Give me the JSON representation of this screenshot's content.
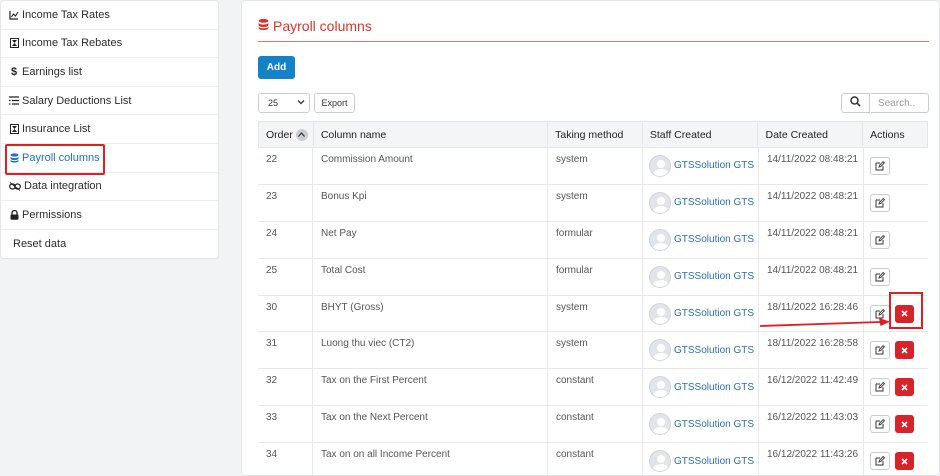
{
  "sidebar": {
    "items": [
      {
        "label": "Income Tax Rates",
        "icon": "chart-icon"
      },
      {
        "label": "Income Tax Rebates",
        "icon": "hourglass-icon"
      },
      {
        "label": "Earnings list",
        "icon": "dollar-icon"
      },
      {
        "label": "Salary Deductions List",
        "icon": "list-icon"
      },
      {
        "label": "Insurance List",
        "icon": "hourglass-icon"
      },
      {
        "label": "Payroll columns",
        "icon": "database-icon",
        "active": true
      },
      {
        "label": "Data integration",
        "icon": "link-icon"
      },
      {
        "label": "Permissions",
        "icon": "lock-icon"
      },
      {
        "label": "Reset data",
        "icon": ""
      }
    ]
  },
  "page": {
    "title": "Payroll columns",
    "add_label": "Add",
    "page_size": "25",
    "export_label": "Export",
    "search_placeholder": "Search.."
  },
  "table": {
    "columns": [
      "Order",
      "Column name",
      "Taking method",
      "Staff Created",
      "Date Created",
      "Actions"
    ],
    "rows": [
      {
        "order": "22",
        "name": "Commission Amount",
        "method": "system",
        "staff": "GTSSolution GTS",
        "date": "14/11/2022 08:48:21",
        "deletable": false
      },
      {
        "order": "23",
        "name": "Bonus Kpi",
        "method": "system",
        "staff": "GTSSolution GTS",
        "date": "14/11/2022 08:48:21",
        "deletable": false
      },
      {
        "order": "24",
        "name": "Net Pay",
        "method": "formular",
        "staff": "GTSSolution GTS",
        "date": "14/11/2022 08:48:21",
        "deletable": false
      },
      {
        "order": "25",
        "name": "Total Cost",
        "method": "formular",
        "staff": "GTSSolution GTS",
        "date": "14/11/2022 08:48:21",
        "deletable": false
      },
      {
        "order": "30",
        "name": "BHYT (Gross)",
        "method": "system",
        "staff": "GTSSolution GTS",
        "date": "18/11/2022 16:28:46",
        "deletable": true
      },
      {
        "order": "31",
        "name": "Luong thu viec (CT2)",
        "method": "system",
        "staff": "GTSSolution GTS",
        "date": "18/11/2022 16:28:58",
        "deletable": true
      },
      {
        "order": "32",
        "name": "Tax on the First Percent",
        "method": "constant",
        "staff": "GTSSolution GTS",
        "date": "16/12/2022 11:42:49",
        "deletable": true
      },
      {
        "order": "33",
        "name": "Tax on the Next Percent",
        "method": "constant",
        "staff": "GTSSolution GTS",
        "date": "16/12/2022 11:43:03",
        "deletable": true
      },
      {
        "order": "34",
        "name": "Tax on on all Income Percent",
        "method": "constant",
        "staff": "GTSSolution GTS",
        "date": "16/12/2022 11:43:26",
        "deletable": true
      }
    ]
  },
  "colors": {
    "accent": "#d9342b",
    "primary": "#1581c9",
    "danger": "#d8232a",
    "link": "#2a6fb8",
    "active_nav": "#1e6fd0"
  }
}
